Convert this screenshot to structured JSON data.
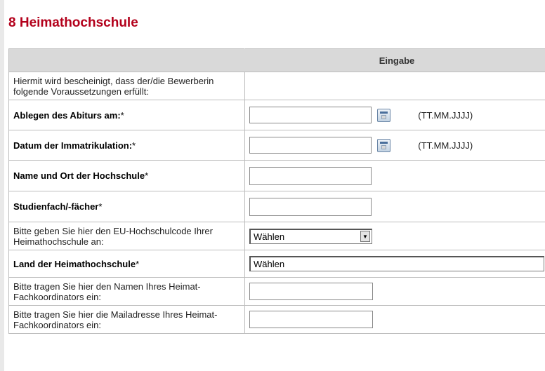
{
  "section": {
    "title": "8 Heimathochschule"
  },
  "table": {
    "header_input": "Eingabe",
    "intro": "Hiermit wird bescheinigt, dass der/die Bewerberin folgende Voraussetzungen erfüllt:",
    "abitur_label": "Ablegen des Abiturs am:",
    "abitur_req": "*",
    "abitur_format": "(TT.MM.JJJJ)",
    "immatrikulation_label": "Datum der Immatrikulation:",
    "immatrikulation_req": "*",
    "immatrikulation_format": "(TT.MM.JJJJ)",
    "hochschule_label": "Name und Ort der Hochschule",
    "hochschule_req": "*",
    "studienfach_label": "Studienfach/-fächer",
    "studienfach_req": "*",
    "eucode_label": "Bitte geben Sie hier den EU-Hochschulcode Ihrer Heimathochschule an:",
    "eucode_value": "Wählen",
    "land_label": "Land der Heimathochschule",
    "land_req": "*",
    "land_value": "Wählen",
    "koordinator_name_label": "Bitte tragen Sie hier den Namen Ihres Heimat-Fachkoordinators ein:",
    "koordinator_mail_label": "Bitte tragen Sie hier die Mailadresse Ihres Heimat-Fachkoordinators ein:"
  },
  "icons": {
    "calendar": "calendar-icon",
    "dropdown": "chevron-down-icon"
  },
  "colors": {
    "title": "#b3001b",
    "header_bg": "#d9d9d9",
    "page_bg": "#e9e9e9"
  }
}
